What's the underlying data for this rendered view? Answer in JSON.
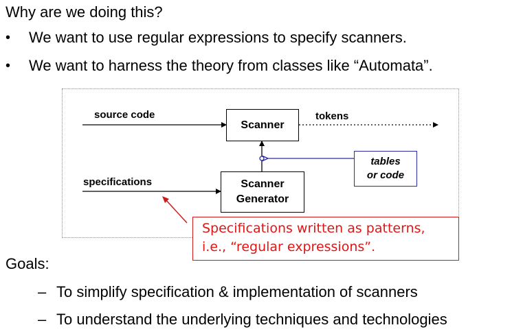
{
  "heading": "Why are we doing this?",
  "bullets": [
    "We want to use regular expressions to specify scanners.",
    "We want to harness the theory from classes like “Automata”."
  ],
  "bullet_symbol": "•",
  "diagram": {
    "source_code_label": "source code",
    "tokens_label": "tokens",
    "specifications_label": "specifications",
    "scanner_box": "Scanner",
    "generator_box_line1": "Scanner",
    "generator_box_line2": "Generator",
    "tables_line1": "tables",
    "tables_line2": "or code"
  },
  "callout": {
    "line1": "Specifications written as patterns,",
    "line2": "i.e., “regular expressions”."
  },
  "goals_heading": "Goals:",
  "dash_symbol": "–",
  "goals": [
    "To simplify specification & implementation of scanners",
    "To understand the underlying techniques and technologies"
  ],
  "colors": {
    "callout": "#e21515",
    "tables_border": "#2b2ba8"
  }
}
